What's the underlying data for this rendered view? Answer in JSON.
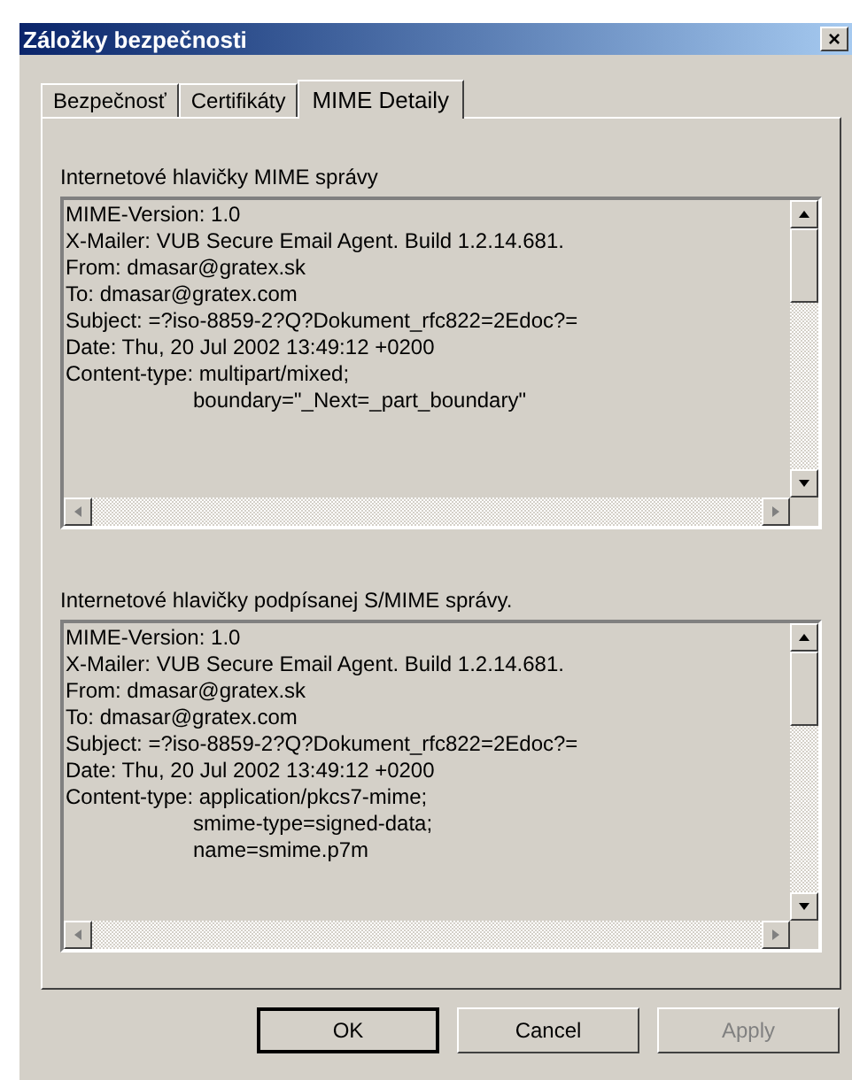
{
  "window": {
    "title": "Záložky bezpečnosti",
    "close": "×"
  },
  "tabs": [
    {
      "label": "Bezpečnosť",
      "selected": false
    },
    {
      "label": "Certifikáty",
      "selected": false
    },
    {
      "label": "MIME Detaily",
      "selected": true
    }
  ],
  "groups": [
    {
      "label": "Internetové hlavičky MIME správy",
      "lines": [
        {
          "text": "MIME-Version: 1.0",
          "indented": false
        },
        {
          "text": "X-Mailer: VUB Secure Email Agent. Build 1.2.14.681.",
          "indented": false
        },
        {
          "text": "From: dmasar@gratex.sk",
          "indented": false
        },
        {
          "text": "To: dmasar@gratex.com",
          "indented": false
        },
        {
          "text": "Subject: =?iso-8859-2?Q?Dokument_rfc822=2Edoc?=",
          "indented": false
        },
        {
          "text": "Date: Thu, 20 Jul 2002 13:49:12 +0200",
          "indented": false
        },
        {
          "text": "Content-type: multipart/mixed;",
          "indented": false
        },
        {
          "text": "boundary=\"_Next=_part_boundary\"",
          "indented": true
        }
      ]
    },
    {
      "label": "Internetové hlavičky podpísanej S/MIME správy.",
      "lines": [
        {
          "text": "MIME-Version: 1.0",
          "indented": false
        },
        {
          "text": "X-Mailer: VUB Secure Email Agent. Build 1.2.14.681.",
          "indented": false
        },
        {
          "text": "From: dmasar@gratex.sk",
          "indented": false
        },
        {
          "text": "To: dmasar@gratex.com",
          "indented": false
        },
        {
          "text": "Subject: =?iso-8859-2?Q?Dokument_rfc822=2Edoc?=",
          "indented": false
        },
        {
          "text": "Date: Thu, 20 Jul 2002 13:49:12 +0200",
          "indented": false
        },
        {
          "text": "Content-type: application/pkcs7-mime;",
          "indented": false
        },
        {
          "text": "smime-type=signed-data;",
          "indented": true
        },
        {
          "text": "name=smime.p7m",
          "indented": true
        }
      ]
    }
  ],
  "buttons": [
    {
      "label": "OK",
      "default": true,
      "disabled": false
    },
    {
      "label": "Cancel",
      "default": false,
      "disabled": false
    },
    {
      "label": "Apply",
      "default": false,
      "disabled": true
    }
  ]
}
